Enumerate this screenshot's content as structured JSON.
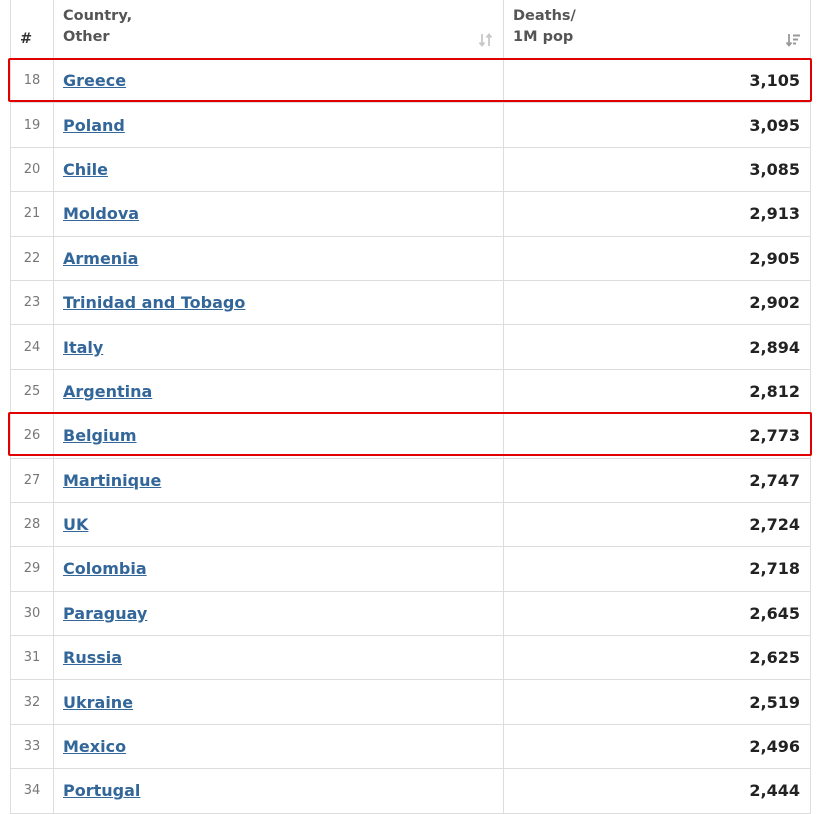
{
  "table": {
    "headers": {
      "rank": "#",
      "country_line1": "Country,",
      "country_line2": "Other",
      "deaths_line1": "Deaths/",
      "deaths_line2": "1M pop"
    },
    "rows": [
      {
        "rank": "18",
        "country": "Greece",
        "deaths": "3,105",
        "highlighted": true
      },
      {
        "rank": "19",
        "country": "Poland",
        "deaths": "3,095"
      },
      {
        "rank": "20",
        "country": "Chile",
        "deaths": "3,085"
      },
      {
        "rank": "21",
        "country": "Moldova",
        "deaths": "2,913"
      },
      {
        "rank": "22",
        "country": "Armenia",
        "deaths": "2,905"
      },
      {
        "rank": "23",
        "country": "Trinidad and Tobago",
        "deaths": "2,902"
      },
      {
        "rank": "24",
        "country": "Italy",
        "deaths": "2,894"
      },
      {
        "rank": "25",
        "country": "Argentina",
        "deaths": "2,812"
      },
      {
        "rank": "26",
        "country": "Belgium",
        "deaths": "2,773",
        "highlighted": true
      },
      {
        "rank": "27",
        "country": "Martinique",
        "deaths": "2,747"
      },
      {
        "rank": "28",
        "country": "UK",
        "deaths": "2,724"
      },
      {
        "rank": "29",
        "country": "Colombia",
        "deaths": "2,718"
      },
      {
        "rank": "30",
        "country": "Paraguay",
        "deaths": "2,645"
      },
      {
        "rank": "31",
        "country": "Russia",
        "deaths": "2,625"
      },
      {
        "rank": "32",
        "country": "Ukraine",
        "deaths": "2,519"
      },
      {
        "rank": "33",
        "country": "Mexico",
        "deaths": "2,496"
      },
      {
        "rank": "34",
        "country": "Portugal",
        "deaths": "2,444"
      }
    ]
  },
  "icons": {
    "country_sort": "sort-neutral-icon",
    "deaths_sort": "sort-descending-icon"
  },
  "colors": {
    "link": "#336699",
    "highlight_border": "#e00000",
    "grid": "#dddddd"
  }
}
